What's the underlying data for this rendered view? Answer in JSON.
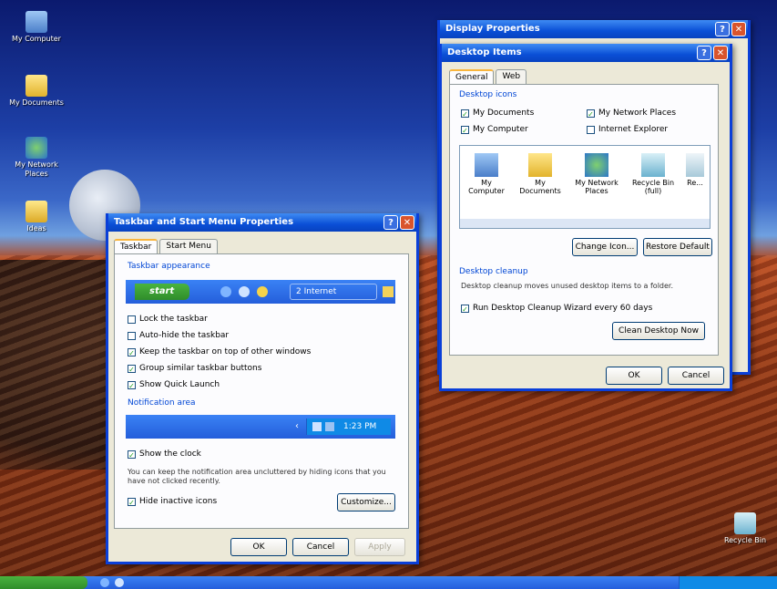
{
  "desktop": {
    "icons": [
      {
        "label": "My Computer"
      },
      {
        "label": "My Documents"
      },
      {
        "label": "My Network Places"
      },
      {
        "label": "Ideas"
      },
      {
        "label": "Recycle Bin"
      }
    ]
  },
  "taskbar_win": {
    "title": "Taskbar and Start Menu Properties",
    "tabs": [
      "Taskbar",
      "Start Menu"
    ],
    "appearance_label": "Taskbar appearance",
    "preview_start": "start",
    "preview_btn": "2 Internet",
    "options": [
      {
        "label": "Lock the taskbar",
        "checked": false
      },
      {
        "label": "Auto-hide the taskbar",
        "checked": false
      },
      {
        "label": "Keep the taskbar on top of other windows",
        "checked": true
      },
      {
        "label": "Group similar taskbar buttons",
        "checked": true
      },
      {
        "label": "Show Quick Launch",
        "checked": true
      }
    ],
    "notification_label": "Notification area",
    "clock_preview": "1:23 PM",
    "show_clock": "Show the clock",
    "hint_text": "You can keep the notification area uncluttered by hiding icons that you have not clicked recently.",
    "hide_inactive": "Hide inactive icons",
    "customize": "Customize...",
    "ok": "OK",
    "cancel": "Cancel",
    "apply": "Apply"
  },
  "display_win": {
    "title": "Display Properties"
  },
  "items_win": {
    "title": "Desktop Items",
    "tabs": [
      "General",
      "Web"
    ],
    "icons_label": "Desktop icons",
    "checks": [
      {
        "label": "My Documents",
        "checked": true
      },
      {
        "label": "My Network Places",
        "checked": true
      },
      {
        "label": "My Computer",
        "checked": true
      },
      {
        "label": "Internet Explorer",
        "checked": false
      }
    ],
    "list": [
      "My Computer",
      "My Documents",
      "My Network Places",
      "Recycle Bin (full)",
      "Re..."
    ],
    "change_icon": "Change Icon...",
    "restore_default": "Restore Default",
    "cleanup_label": "Desktop cleanup",
    "cleanup_text": "Desktop cleanup moves unused desktop items to a folder.",
    "cleanup_check": "Run Desktop Cleanup Wizard every 60 days",
    "clean_now": "Clean Desktop Now",
    "ok": "OK",
    "cancel": "Cancel"
  },
  "colors": {
    "xp_blue": "#0a4fd6",
    "start_green": "#2f8d2a",
    "dialog_bg": "#ece9d8"
  }
}
